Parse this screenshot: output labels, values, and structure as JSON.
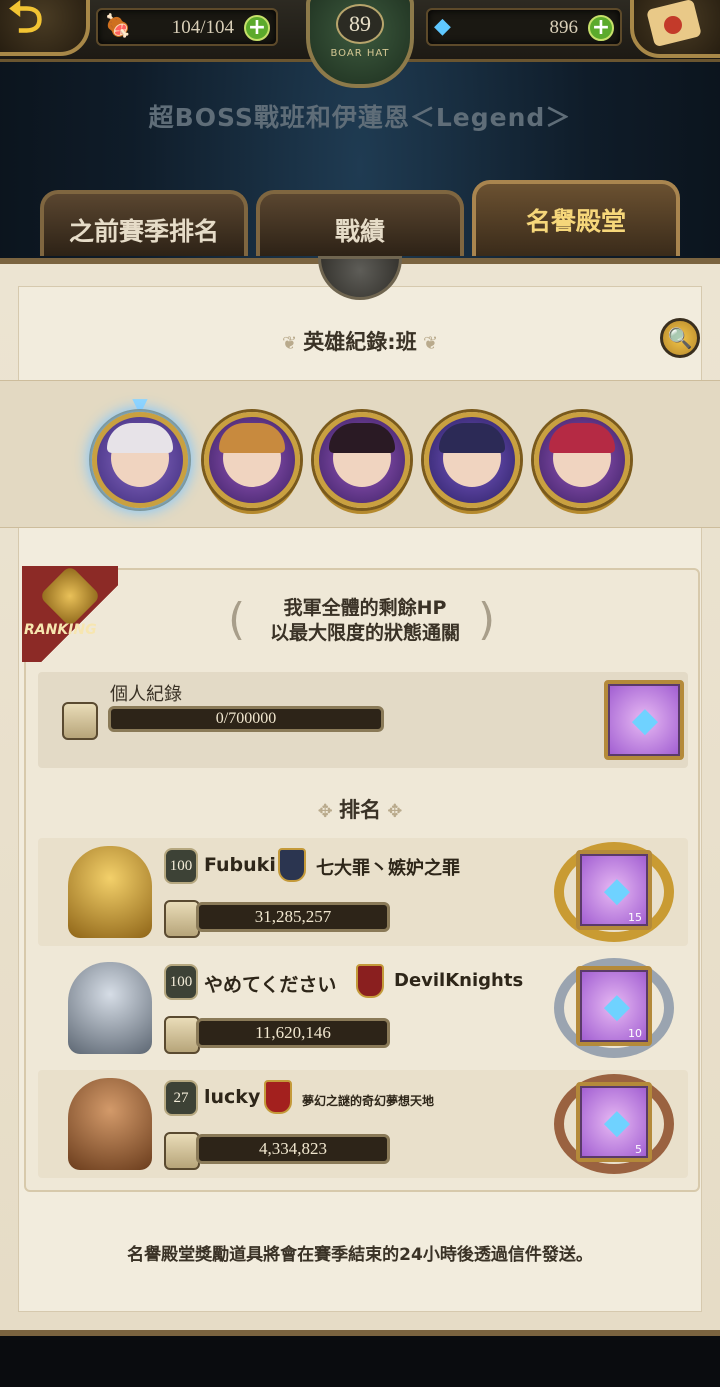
{
  "topbar": {
    "stamina": "104/104",
    "gems": "896",
    "level": "89",
    "emblem_label": "BOAR HAT",
    "plus_symbol": "+"
  },
  "stage_title": "超BOSS戰班和伊蓮恩＜Legend＞",
  "tabs": [
    {
      "label": "之前賽季排名",
      "active": false
    },
    {
      "label": "戰績",
      "active": false
    },
    {
      "label": "名譽殿堂",
      "active": true
    }
  ],
  "hero_section": {
    "title": "英雄紀錄:班",
    "heroes": [
      "hero-1",
      "hero-2",
      "hero-3",
      "hero-4",
      "hero-5"
    ]
  },
  "ranking": {
    "badge_label": "RANKING",
    "condition_line1": "我軍全體的剩餘HP",
    "condition_line2": "以最大限度的狀態通關",
    "personal_label": "個人紀錄",
    "personal_progress": "0/700000",
    "section_title": "排名",
    "rows": [
      {
        "rank": 1,
        "level": "100",
        "name": "Fubuki",
        "guild": "七大罪丶嫉妒之罪",
        "score": "31,285,257",
        "reward_qty": "15",
        "guild_color": "#2b3550"
      },
      {
        "rank": 2,
        "level": "100",
        "name": "やめてください",
        "guild": "DevilKnights",
        "score": "11,620,146",
        "reward_qty": "10",
        "guild_color": "#8a1f1f"
      },
      {
        "rank": 3,
        "level": "27",
        "name": "lucky",
        "guild": "夢幻之謎的奇幻夢想天地",
        "score": "4,334,823",
        "reward_qty": "5",
        "guild_color": "#a3201e"
      }
    ]
  },
  "footer_note": "名譽殿堂獎勵道具將會在賽季結束的24小時後透過信件發送。",
  "colors": {
    "accent_gold": "#f6d77a",
    "parchment": "#f2ecdd",
    "bar_dark": "#2d2418"
  }
}
